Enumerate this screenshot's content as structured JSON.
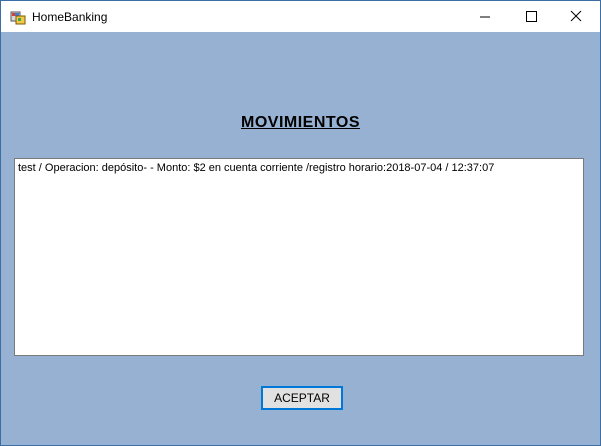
{
  "window": {
    "title": "HomeBanking",
    "controls": {
      "minimize": "minimize-icon",
      "maximize": "maximize-icon",
      "close": "close-icon"
    }
  },
  "main": {
    "heading": "MOVIMIENTOS",
    "movements": [
      "test / Operacion: depósito- - Monto: $2 en cuenta corriente /registro horario:2018-07-04 / 12:37:07"
    ],
    "accept_button_label": "ACEPTAR"
  },
  "colors": {
    "background": "#97b1d2",
    "titlebar": "#ffffff",
    "button_border": "#0078d7",
    "button_face": "#e1e1e1"
  }
}
